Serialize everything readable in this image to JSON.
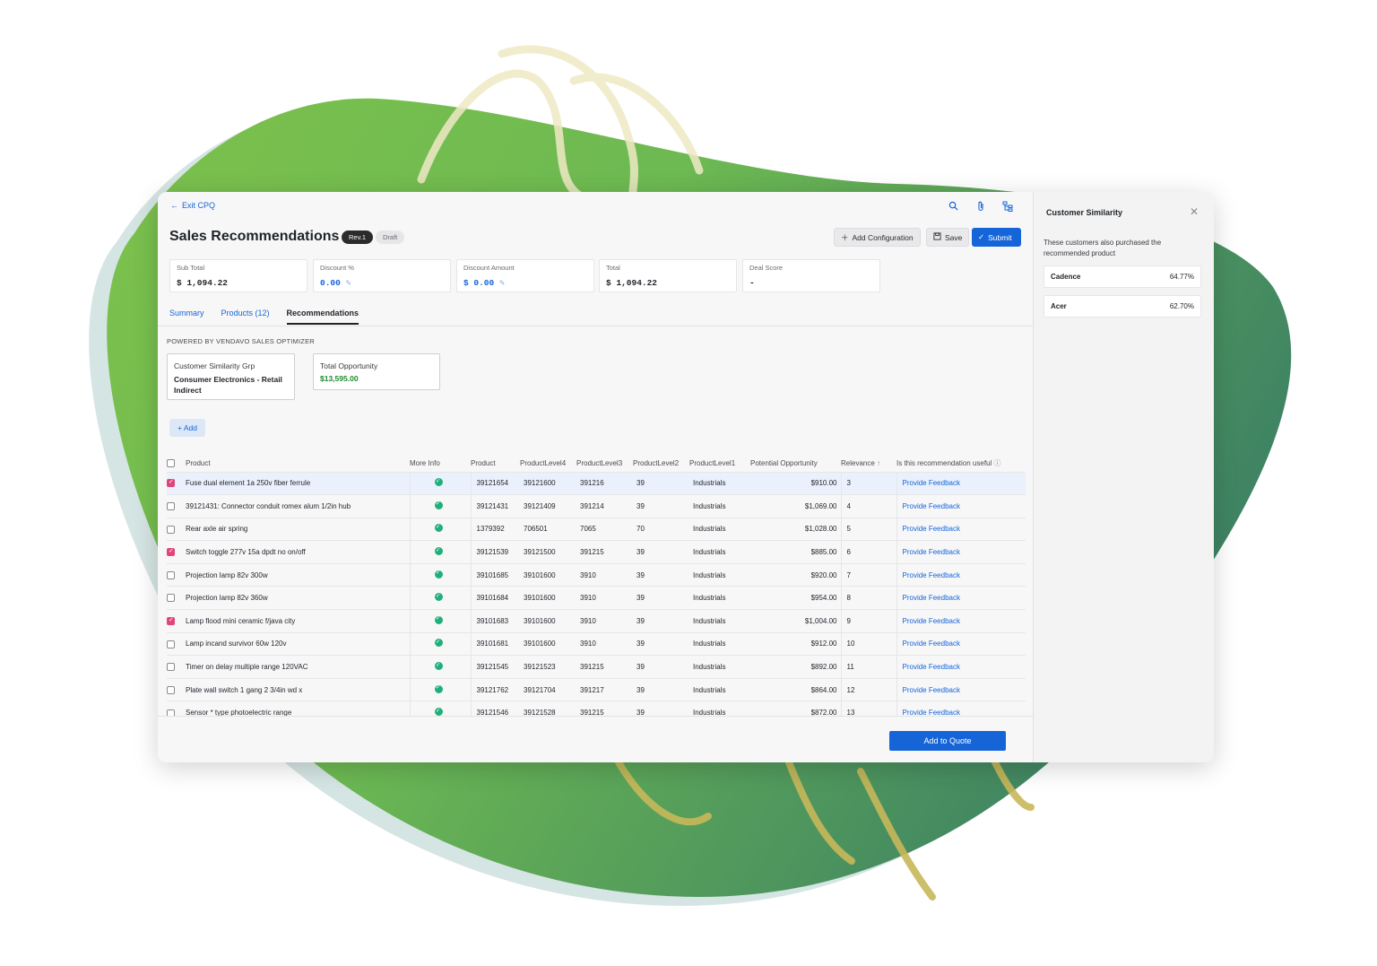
{
  "header": {
    "exit_label": "Exit CPQ",
    "page_title": "Sales Recommendations",
    "rev_badge": "Rev.1",
    "status_badge": "Draft",
    "add_config_label": "Add Configuration",
    "save_label": "Save",
    "submit_label": "Submit"
  },
  "summary_cards": [
    {
      "label": "Sub Total",
      "value": "$ 1,094.22"
    },
    {
      "label": "Discount %",
      "value": "0.00"
    },
    {
      "label": "Discount Amount",
      "value": "$ 0.00"
    },
    {
      "label": "Total",
      "value": "$ 1,094.22"
    },
    {
      "label": "Deal Score",
      "value": "-"
    }
  ],
  "tabs": [
    {
      "label": "Summary"
    },
    {
      "label": "Products (12)"
    },
    {
      "label": "Recommendations"
    }
  ],
  "optimizer": {
    "powered_by": "POWERED BY VENDAVO SALES OPTIMIZER",
    "group_label": "Customer Similarity Grp",
    "group_value": "Consumer Electronics - Retail Indirect",
    "opportunity_label": "Total Opportunity",
    "opportunity_value": "$13,595.00",
    "add_label": "+ Add"
  },
  "table": {
    "headers": [
      "Product",
      "More Info",
      "Product",
      "ProductLevel4",
      "ProductLevel3",
      "ProductLevel2",
      "ProductLevel1",
      "Potential Opportunity",
      "Relevance",
      "Is this recommendation useful"
    ],
    "rows": [
      {
        "checked": true,
        "name": "Fuse dual element 1a 250v fiber ferrule",
        "product": "39121654",
        "l4": "39121600",
        "l3": "391216",
        "l2": "39",
        "l1": "Industrials",
        "opportunity": "$910.00",
        "relevance": "3",
        "feedback": "Provide Feedback"
      },
      {
        "checked": false,
        "name": "39121431: Connector conduit romex alum 1/2in hub",
        "product": "39121431",
        "l4": "39121409",
        "l3": "391214",
        "l2": "39",
        "l1": "Industrials",
        "opportunity": "$1,069.00",
        "relevance": "4",
        "feedback": "Provide Feedback"
      },
      {
        "checked": false,
        "name": "Rear axle air spring",
        "product": "1379392",
        "l4": "706501",
        "l3": "7065",
        "l2": "70",
        "l1": "Industrials",
        "opportunity": "$1,028.00",
        "relevance": "5",
        "feedback": "Provide Feedback"
      },
      {
        "checked": true,
        "name": "Switch toggle 277v 15a dpdt no on/off",
        "product": "39121539",
        "l4": "39121500",
        "l3": "391215",
        "l2": "39",
        "l1": "Industrials",
        "opportunity": "$885.00",
        "relevance": "6",
        "feedback": "Provide Feedback"
      },
      {
        "checked": false,
        "name": "Projection lamp 82v 300w",
        "product": "39101685",
        "l4": "39101600",
        "l3": "3910",
        "l2": "39",
        "l1": "Industrials",
        "opportunity": "$920.00",
        "relevance": "7",
        "feedback": "Provide Feedback"
      },
      {
        "checked": false,
        "name": "Projection lamp 82v 360w",
        "product": "39101684",
        "l4": "39101600",
        "l3": "3910",
        "l2": "39",
        "l1": "Industrials",
        "opportunity": "$954.00",
        "relevance": "8",
        "feedback": "Provide Feedback"
      },
      {
        "checked": true,
        "name": "Lamp flood mini ceramic f/java city",
        "product": "39101683",
        "l4": "39101600",
        "l3": "3910",
        "l2": "39",
        "l1": "Industrials",
        "opportunity": "$1,004.00",
        "relevance": "9",
        "feedback": "Provide Feedback"
      },
      {
        "checked": false,
        "name": "Lamp incand survivor 60w 120v",
        "product": "39101681",
        "l4": "39101600",
        "l3": "3910",
        "l2": "39",
        "l1": "Industrials",
        "opportunity": "$912.00",
        "relevance": "10",
        "feedback": "Provide Feedback"
      },
      {
        "checked": false,
        "name": "Timer on delay multiple range 120VAC",
        "product": "39121545",
        "l4": "39121523",
        "l3": "391215",
        "l2": "39",
        "l1": "Industrials",
        "opportunity": "$892.00",
        "relevance": "11",
        "feedback": "Provide Feedback"
      },
      {
        "checked": false,
        "name": "Plate wall switch 1 gang 2 3/4in wd x",
        "product": "39121762",
        "l4": "39121704",
        "l3": "391217",
        "l2": "39",
        "l1": "Industrials",
        "opportunity": "$864.00",
        "relevance": "12",
        "feedback": "Provide Feedback"
      },
      {
        "checked": false,
        "name": "Sensor * type photoelectric range",
        "product": "39121546",
        "l4": "39121528",
        "l3": "391215",
        "l2": "39",
        "l1": "Industrials",
        "opportunity": "$872.00",
        "relevance": "13",
        "feedback": "Provide Feedback"
      }
    ]
  },
  "footer": {
    "add_to_quote_label": "Add to Quote"
  },
  "side_panel": {
    "title": "Customer Similarity",
    "description": "These customers also purchased the recommended product",
    "customers": [
      {
        "name": "Cadence",
        "value": "64.77%"
      },
      {
        "name": "Acer",
        "value": "62.70%"
      }
    ]
  },
  "colors": {
    "accent": "#1565d8",
    "check": "#e0457b",
    "ok": "#1fb07a",
    "opportunity": "#1f8a2e"
  }
}
